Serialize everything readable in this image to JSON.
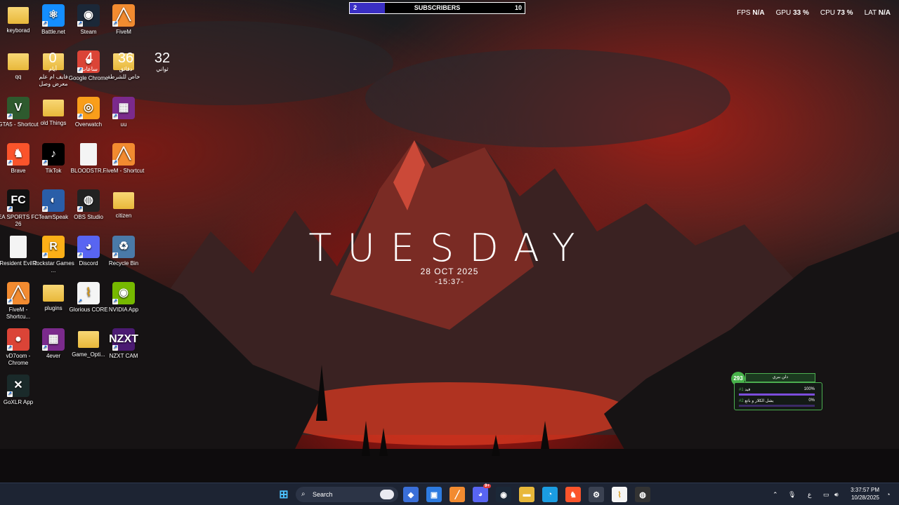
{
  "desktop": {
    "icons": [
      {
        "label": "keyborad",
        "icon": "folder-icon",
        "type": "folder"
      },
      {
        "label": "Battle.net",
        "icon": "battlenet-icon",
        "type": "app",
        "color": "#148eff",
        "glyph": "⚛"
      },
      {
        "label": "Steam",
        "icon": "steam-icon",
        "type": "app",
        "color": "#1b2838",
        "glyph": "◉"
      },
      {
        "label": "FiveM",
        "icon": "fivem-icon",
        "type": "app",
        "color": "#f28b30",
        "glyph": "╱╲"
      },
      {
        "label": "qq",
        "icon": "folder-icon",
        "type": "folder"
      },
      {
        "label": "فايف ام\nعلم معرض وصل",
        "icon": "folder-icon",
        "type": "folder"
      },
      {
        "label": "Google Chrome",
        "icon": "chrome-icon",
        "type": "app",
        "color": "#db4437",
        "glyph": "●"
      },
      {
        "label": "خاص للشرطة",
        "icon": "folder-icon",
        "type": "folder"
      },
      {
        "label": "GTA5 - Shortcut",
        "icon": "gta5-icon",
        "type": "app",
        "color": "#2e5a2e",
        "glyph": "V"
      },
      {
        "label": "old Things",
        "icon": "folder-icon",
        "type": "folder"
      },
      {
        "label": "Overwatch",
        "icon": "overwatch-icon",
        "type": "app",
        "color": "#f99e1a",
        "glyph": "◎"
      },
      {
        "label": "uu",
        "icon": "winrar-icon",
        "type": "app",
        "color": "#7b2a8c",
        "glyph": "▦"
      },
      {
        "label": "Brave",
        "icon": "brave-icon",
        "type": "app",
        "color": "#fb542b",
        "glyph": "♞"
      },
      {
        "label": "TikTok",
        "icon": "tiktok-icon",
        "type": "app",
        "color": "#000000",
        "glyph": "♪"
      },
      {
        "label": "BLOODSTR...",
        "icon": "file-icon",
        "type": "file"
      },
      {
        "label": "FiveM - Shortcut",
        "icon": "fivem-icon",
        "type": "app",
        "color": "#f28b30",
        "glyph": "╱╲"
      },
      {
        "label": "EA SPORTS FC 26",
        "icon": "easports-icon",
        "type": "app",
        "color": "#111111",
        "glyph": "FC"
      },
      {
        "label": "TeamSpeak",
        "icon": "teamspeak-icon",
        "type": "app",
        "color": "#2a5ea8",
        "glyph": "◐"
      },
      {
        "label": "OBS Studio",
        "icon": "obs-icon",
        "type": "app",
        "color": "#222222",
        "glyph": "◍"
      },
      {
        "label": "citizen",
        "icon": "folder-icon",
        "type": "folder"
      },
      {
        "label": "Resident Evil 2",
        "icon": "file-icon",
        "type": "file"
      },
      {
        "label": "Rockstar Games ...",
        "icon": "rockstar-icon",
        "type": "app",
        "color": "#fcaf17",
        "glyph": "R"
      },
      {
        "label": "Discord",
        "icon": "discord-icon",
        "type": "app",
        "color": "#5865f2",
        "glyph": "◕"
      },
      {
        "label": "Recycle Bin",
        "icon": "recycle-bin-icon",
        "type": "app",
        "color": "#4a7aa8",
        "glyph": "♻"
      },
      {
        "label": "FiveM - Shortcu...",
        "icon": "fivem-icon",
        "type": "app",
        "color": "#f28b30",
        "glyph": "╱╲"
      },
      {
        "label": "plugins",
        "icon": "folder-icon",
        "type": "folder"
      },
      {
        "label": "Glorious CORE",
        "icon": "glorious-icon",
        "type": "app",
        "color": "#f5f5f5",
        "glyph": "⌇"
      },
      {
        "label": "NVIDIA App",
        "icon": "nvidia-icon",
        "type": "app",
        "color": "#76b900",
        "glyph": "◉"
      },
      {
        "label": "vD7oom - Chrome",
        "icon": "chrome-icon",
        "type": "app",
        "color": "#db4437",
        "glyph": "●"
      },
      {
        "label": "4ever",
        "icon": "winrar-icon",
        "type": "app",
        "color": "#7b2a8c",
        "glyph": "▦"
      },
      {
        "label": "Game_Opti...",
        "icon": "folder-icon",
        "type": "folder"
      },
      {
        "label": "NZXT CAM",
        "icon": "nzxt-icon",
        "type": "app",
        "color": "#4b1a72",
        "glyph": "NZXT"
      },
      {
        "label": "GoXLR App",
        "icon": "goxlr-icon",
        "type": "app",
        "color": "#1a2a2a",
        "glyph": "✕"
      }
    ]
  },
  "subscribers": {
    "current": "2",
    "title": "SUBSCRIBERS",
    "goal": "10",
    "fill_fraction": 0.2
  },
  "stats": {
    "fps_label": "FPS",
    "fps_value": "N/A",
    "gpu_label": "GPU",
    "gpu_value": "33 %",
    "cpu_label": "CPU",
    "cpu_value": "73 %",
    "lat_label": "LAT",
    "lat_value": "N/A"
  },
  "countdown": [
    {
      "num": "0",
      "unit": "أيام"
    },
    {
      "num": "4",
      "unit": "ساعات"
    },
    {
      "num": "36",
      "unit": "دقائق"
    },
    {
      "num": "32",
      "unit": "ثواني"
    }
  ],
  "clock_widget": {
    "day": "TUESDAY",
    "date": "28 OCT 2025",
    "time": "-15:37-"
  },
  "widget": {
    "badge": "293",
    "header": "دلن ببري",
    "rows": [
      {
        "rank": "#1",
        "name": "فيد",
        "percent": "100%",
        "fill": 1.0
      },
      {
        "rank": "#2",
        "name": "يشل الكلار و باتع",
        "percent": "0%",
        "fill": 0.0
      }
    ]
  },
  "taskbar": {
    "search_placeholder": "Search",
    "apps": [
      {
        "name": "m365-icon",
        "glyph": "◆",
        "color": "#3a6fd8"
      },
      {
        "name": "store-icon",
        "glyph": "▣",
        "color": "#2d7be0"
      },
      {
        "name": "fivem-icon",
        "glyph": "╱",
        "color": "#f28b30"
      },
      {
        "name": "discord-icon",
        "glyph": "◕",
        "color": "#5865f2",
        "badge": "9+"
      },
      {
        "name": "steam-icon",
        "glyph": "◉",
        "color": "#1b2838"
      },
      {
        "name": "file-explorer-icon",
        "glyph": "▬",
        "color": "#e8b83a"
      },
      {
        "name": "edge-icon",
        "glyph": "◔",
        "color": "#1b9de2"
      },
      {
        "name": "brave-icon",
        "glyph": "♞",
        "color": "#fb542b"
      },
      {
        "name": "settings-icon",
        "glyph": "⚙",
        "color": "#3b4252"
      },
      {
        "name": "glorious-icon",
        "glyph": "⌇",
        "color": "#f5f5f5"
      },
      {
        "name": "obs-icon",
        "glyph": "◍",
        "color": "#333333"
      }
    ],
    "tray": {
      "lang": "ع",
      "time": "3:37:57 PM",
      "date": "10/28/2025"
    }
  }
}
